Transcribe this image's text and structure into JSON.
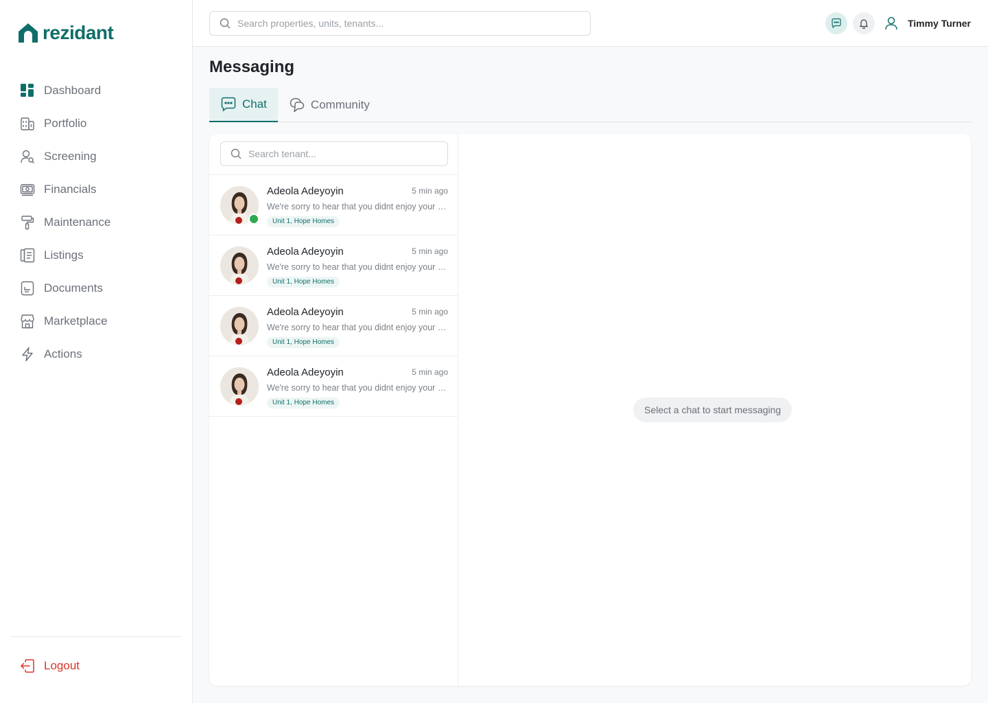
{
  "brand": {
    "name": "rezidant",
    "color": "#0f6e6a"
  },
  "sidebar": {
    "items": [
      {
        "label": "Dashboard",
        "icon": "dashboard-icon"
      },
      {
        "label": "Portfolio",
        "icon": "building-icon"
      },
      {
        "label": "Screening",
        "icon": "user-search-icon"
      },
      {
        "label": "Financials",
        "icon": "money-icon"
      },
      {
        "label": "Maintenance",
        "icon": "paint-roller-icon"
      },
      {
        "label": "Listings",
        "icon": "listing-icon"
      },
      {
        "label": "Documents",
        "icon": "document-icon"
      },
      {
        "label": "Marketplace",
        "icon": "storefront-icon"
      },
      {
        "label": "Actions",
        "icon": "lightning-icon"
      }
    ],
    "logout_label": "Logout"
  },
  "header": {
    "search_placeholder": "Search properties, units, tenants...",
    "user_name": "Timmy Turner"
  },
  "main": {
    "title": "Messaging",
    "tabs": [
      {
        "label": "Chat",
        "active": true
      },
      {
        "label": "Community",
        "active": false
      }
    ],
    "tenant_search_placeholder": "Search tenant...",
    "chats": [
      {
        "name": "Adeola Adeyoyin",
        "time": "5 min ago",
        "preview": "We're sorry to hear that you didnt enjoy your experience with us",
        "tag": "Unit 1, Hope Homes",
        "online": true
      },
      {
        "name": "Adeola Adeyoyin",
        "time": "5 min ago",
        "preview": "We're sorry to hear that you didnt enjoy your experience with us",
        "tag": "Unit 1, Hope Homes",
        "online": false
      },
      {
        "name": "Adeola Adeyoyin",
        "time": "5 min ago",
        "preview": "We're sorry to hear that you didnt enjoy your experience with us",
        "tag": "Unit 1, Hope Homes",
        "online": false
      },
      {
        "name": "Adeola Adeyoyin",
        "time": "5 min ago",
        "preview": "We're sorry to hear that you didnt enjoy your experience with us",
        "tag": "Unit 1, Hope Homes",
        "online": false
      }
    ],
    "empty_state": "Select a chat to start messaging"
  }
}
